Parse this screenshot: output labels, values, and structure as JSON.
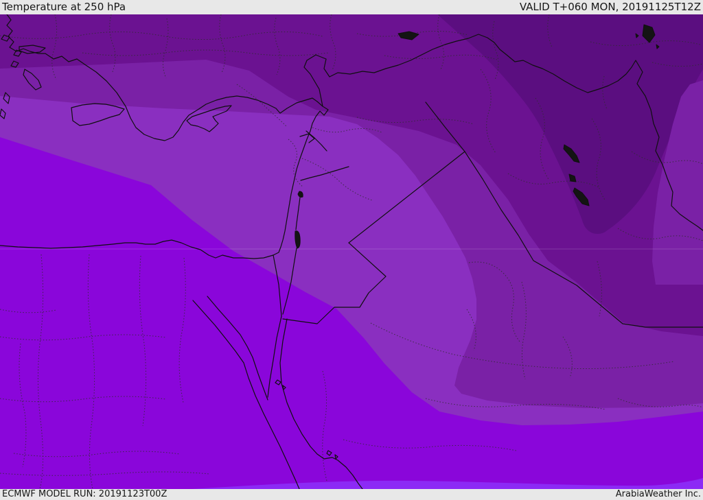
{
  "header": {
    "title": "Temperature at 250 hPa",
    "valid_label": "VALID T+060 MON, 20191125T12Z"
  },
  "footer": {
    "model_run_label": "ECMWF MODEL RUN: 20191123T00Z",
    "brand_label": "ArabiaWeather Inc."
  },
  "map": {
    "region": "Eastern Mediterranean / Middle East",
    "colors": {
      "band_warmest": "#8c2af5",
      "band_warm": "#8a06da",
      "band_mid_warm": "#8a2fc0",
      "band_mid": "#7a21a6",
      "band_cold": "#6b1291",
      "band_coldest": "#5b0e80",
      "bar_background": "#e8e8e8",
      "bar_text": "#161616",
      "border_line": "#0f0f0f"
    },
    "bands": [
      {
        "name": "warmest",
        "color": "#8c2af5"
      },
      {
        "name": "warm",
        "color": "#8a06da"
      },
      {
        "name": "mid-warm",
        "color": "#8a2fc0"
      },
      {
        "name": "mid",
        "color": "#7a21a6"
      },
      {
        "name": "cold",
        "color": "#6b1291"
      },
      {
        "name": "coldest",
        "color": "#5b0e80"
      }
    ]
  }
}
